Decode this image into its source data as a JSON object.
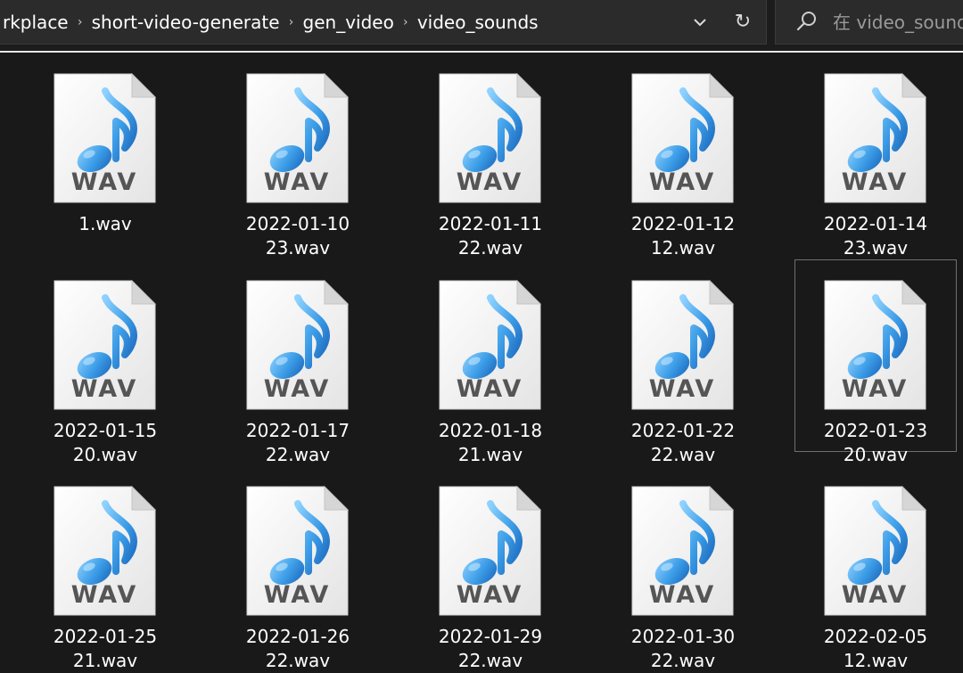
{
  "address_bar": {
    "crumbs": [
      "rkplace",
      "short-video-generate",
      "gen_video",
      "video_sounds"
    ]
  },
  "search": {
    "placeholder": "在 video_sounds"
  },
  "icon_badge": "WAV",
  "files": [
    {
      "line1": "1.wav",
      "line2": ""
    },
    {
      "line1": "2022-01-10",
      "line2": "23.wav"
    },
    {
      "line1": "2022-01-11",
      "line2": "22.wav"
    },
    {
      "line1": "2022-01-12",
      "line2": "12.wav"
    },
    {
      "line1": "2022-01-14",
      "line2": "23.wav"
    },
    {
      "line1": "2022-01-15",
      "line2": "20.wav"
    },
    {
      "line1": "2022-01-17",
      "line2": "22.wav"
    },
    {
      "line1": "2022-01-18",
      "line2": "21.wav"
    },
    {
      "line1": "2022-01-22",
      "line2": "22.wav"
    },
    {
      "line1": "2022-01-23",
      "line2": "20.wav",
      "selected": true
    },
    {
      "line1": "2022-01-25",
      "line2": "21.wav"
    },
    {
      "line1": "2022-01-26",
      "line2": "22.wav"
    },
    {
      "line1": "2022-01-29",
      "line2": "22.wav"
    },
    {
      "line1": "2022-01-30",
      "line2": "22.wav"
    },
    {
      "line1": "2022-02-05",
      "line2": "12.wav"
    }
  ],
  "colors": {
    "background": "#191919",
    "note_blue": "#3a9be6",
    "badge_text": "#555555"
  }
}
